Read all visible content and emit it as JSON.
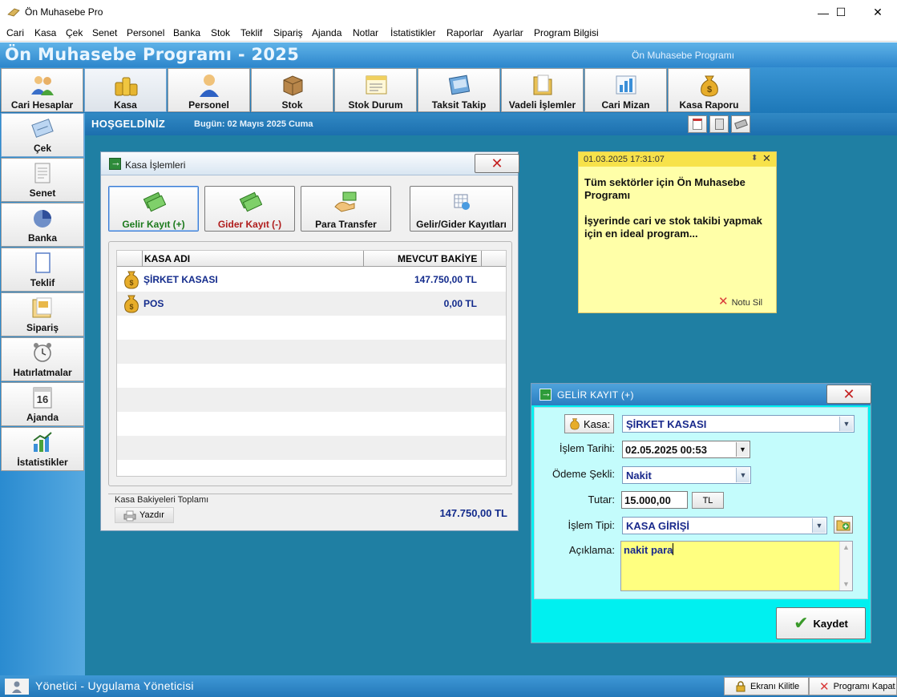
{
  "window": {
    "title": "Ön Muhasebe Pro",
    "minimize_glyph": "—",
    "maximize_glyph": "☐",
    "close_glyph": "✕"
  },
  "menu": [
    "Cari",
    "Kasa",
    "Çek",
    "Senet",
    "Personel",
    "Banka",
    "Stok",
    "Teklif",
    "Sipariş",
    "Ajanda",
    "Notlar",
    "İstatistikler",
    "Raporlar",
    "Ayarlar",
    "Program Bilgisi"
  ],
  "banner": {
    "title": "Ön Muhasebe Programı - 2025",
    "subtitle": "Ön Muhasebe Programı"
  },
  "toolbar": [
    {
      "label": "Cari Hesaplar",
      "icon": "users-icon"
    },
    {
      "label": "Kasa",
      "icon": "coins-icon"
    },
    {
      "label": "Personel",
      "icon": "person-icon"
    },
    {
      "label": "Stok",
      "icon": "box-icon"
    },
    {
      "label": "Stok Durum",
      "icon": "report-icon"
    },
    {
      "label": "Taksit Takip",
      "icon": "card-icon"
    },
    {
      "label": "Vadeli İşlemler",
      "icon": "folder-icon"
    },
    {
      "label": "Cari Mizan",
      "icon": "chart-icon"
    },
    {
      "label": "Kasa Raporu",
      "icon": "money-bag-icon"
    }
  ],
  "sidebar": [
    {
      "label": "Çek",
      "icon": "check-doc-icon"
    },
    {
      "label": "Senet",
      "icon": "document-icon"
    },
    {
      "label": "Banka",
      "icon": "pie-icon"
    },
    {
      "label": "Teklif",
      "icon": "paper-icon"
    },
    {
      "label": "Sipariş",
      "icon": "order-icon"
    },
    {
      "label": "Hatırlatmalar",
      "icon": "clock-icon"
    },
    {
      "label": "Ajanda",
      "icon": "calendar-icon"
    },
    {
      "label": "İstatistikler",
      "icon": "stats-icon"
    }
  ],
  "welcome": {
    "text": "HOŞGELDİNİZ",
    "date": "Bugün: 02 Mayıs 2025 Cuma",
    "calendar_day": "16"
  },
  "kasa_window": {
    "title": "Kasa İşlemleri",
    "buttons": {
      "gelir": "Gelir Kayıt (+)",
      "gider": "Gider Kayıt (-)",
      "transfer": "Para Transfer",
      "kayitlar": "Gelir/Gider Kayıtları"
    },
    "columns": [
      "KASA ADI",
      "MEVCUT BAKİYE"
    ],
    "rows": [
      {
        "name": "ŞİRKET KASASI",
        "balance": "147.750,00 TL"
      },
      {
        "name": "POS",
        "balance": "0,00 TL"
      }
    ],
    "footer_title": "Kasa Bakiyeleri Toplamı",
    "print_label": "Yazdır",
    "total": "147.750,00 TL"
  },
  "note": {
    "timestamp": "01.03.2025 17:31:07",
    "text": "Tüm sektörler için Ön Muhasebe Programı\n\nİşyerinde cari ve stok takibi yapmak için en ideal program...",
    "delete_label": "Notu Sil"
  },
  "gelir_window": {
    "title": "GELİR KAYIT (+)",
    "kasa_label": "Kasa:",
    "kasa_value": "ŞİRKET KASASI",
    "tarih_label": "İşlem Tarihi:",
    "tarih_value": "02.05.2025 00:53",
    "odeme_label": "Ödeme Şekli:",
    "odeme_value": "Nakit",
    "tutar_label": "Tutar:",
    "tutar_value": "15.000,00",
    "currency": "TL",
    "tip_label": "İşlem Tipi:",
    "tip_value": "KASA GİRİŞİ",
    "aciklama_label": "Açıklama:",
    "aciklama_value": "nakit para",
    "save_label": "Kaydet"
  },
  "statusbar": {
    "user": "Yönetici - Uygulama Yöneticisi",
    "lock_label": "Ekranı Kilitle",
    "exit_label": "Programı Kapat"
  },
  "colors": {
    "accent_blue": "#2d86cc",
    "main_teal": "#1f7fa3",
    "note_yellow": "#ffffa8",
    "gelir_cyan": "#00f0f0",
    "value_text": "#132b8c"
  }
}
